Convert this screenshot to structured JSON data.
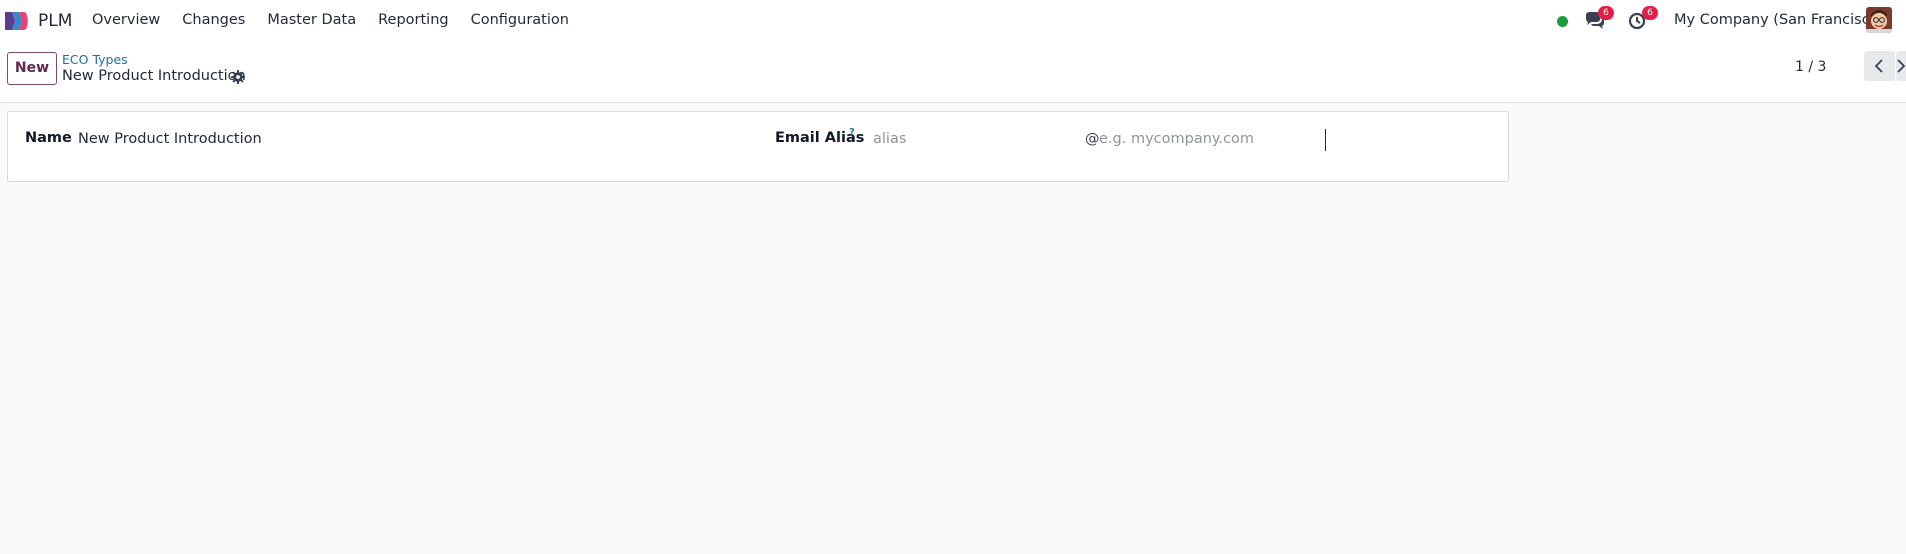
{
  "app": {
    "name": "PLM",
    "logo_icon": "plm-app-logo-icon"
  },
  "menu": {
    "items": [
      {
        "label": "Overview"
      },
      {
        "label": "Changes"
      },
      {
        "label": "Master Data"
      },
      {
        "label": "Reporting"
      },
      {
        "label": "Configuration"
      }
    ]
  },
  "systray": {
    "status_color": "#1d9a3b",
    "messages": {
      "icon": "chat-bubbles-icon",
      "count": "6"
    },
    "activities": {
      "icon": "clock-icon",
      "count": "6"
    },
    "badge_color": "#e11d48",
    "company": "My Company (San Francisco)",
    "avatar_icon": "user-avatar"
  },
  "control_panel": {
    "new_label": "New",
    "breadcrumb_parent": "ECO Types",
    "breadcrumb_current": "New Product Introduction",
    "pager_value": "1 / 3"
  },
  "form": {
    "name_label": "Name",
    "name_value": "New Product Introduction",
    "alias_label": "Email Alias",
    "alias_help": "?",
    "alias_placeholder": "alias",
    "alias_value": "",
    "at_sign": "@",
    "domain_placeholder": "e.g. mycompany.com",
    "domain_value": ""
  },
  "colors": {
    "accent": "#714b67",
    "link": "#1f6fa3"
  }
}
